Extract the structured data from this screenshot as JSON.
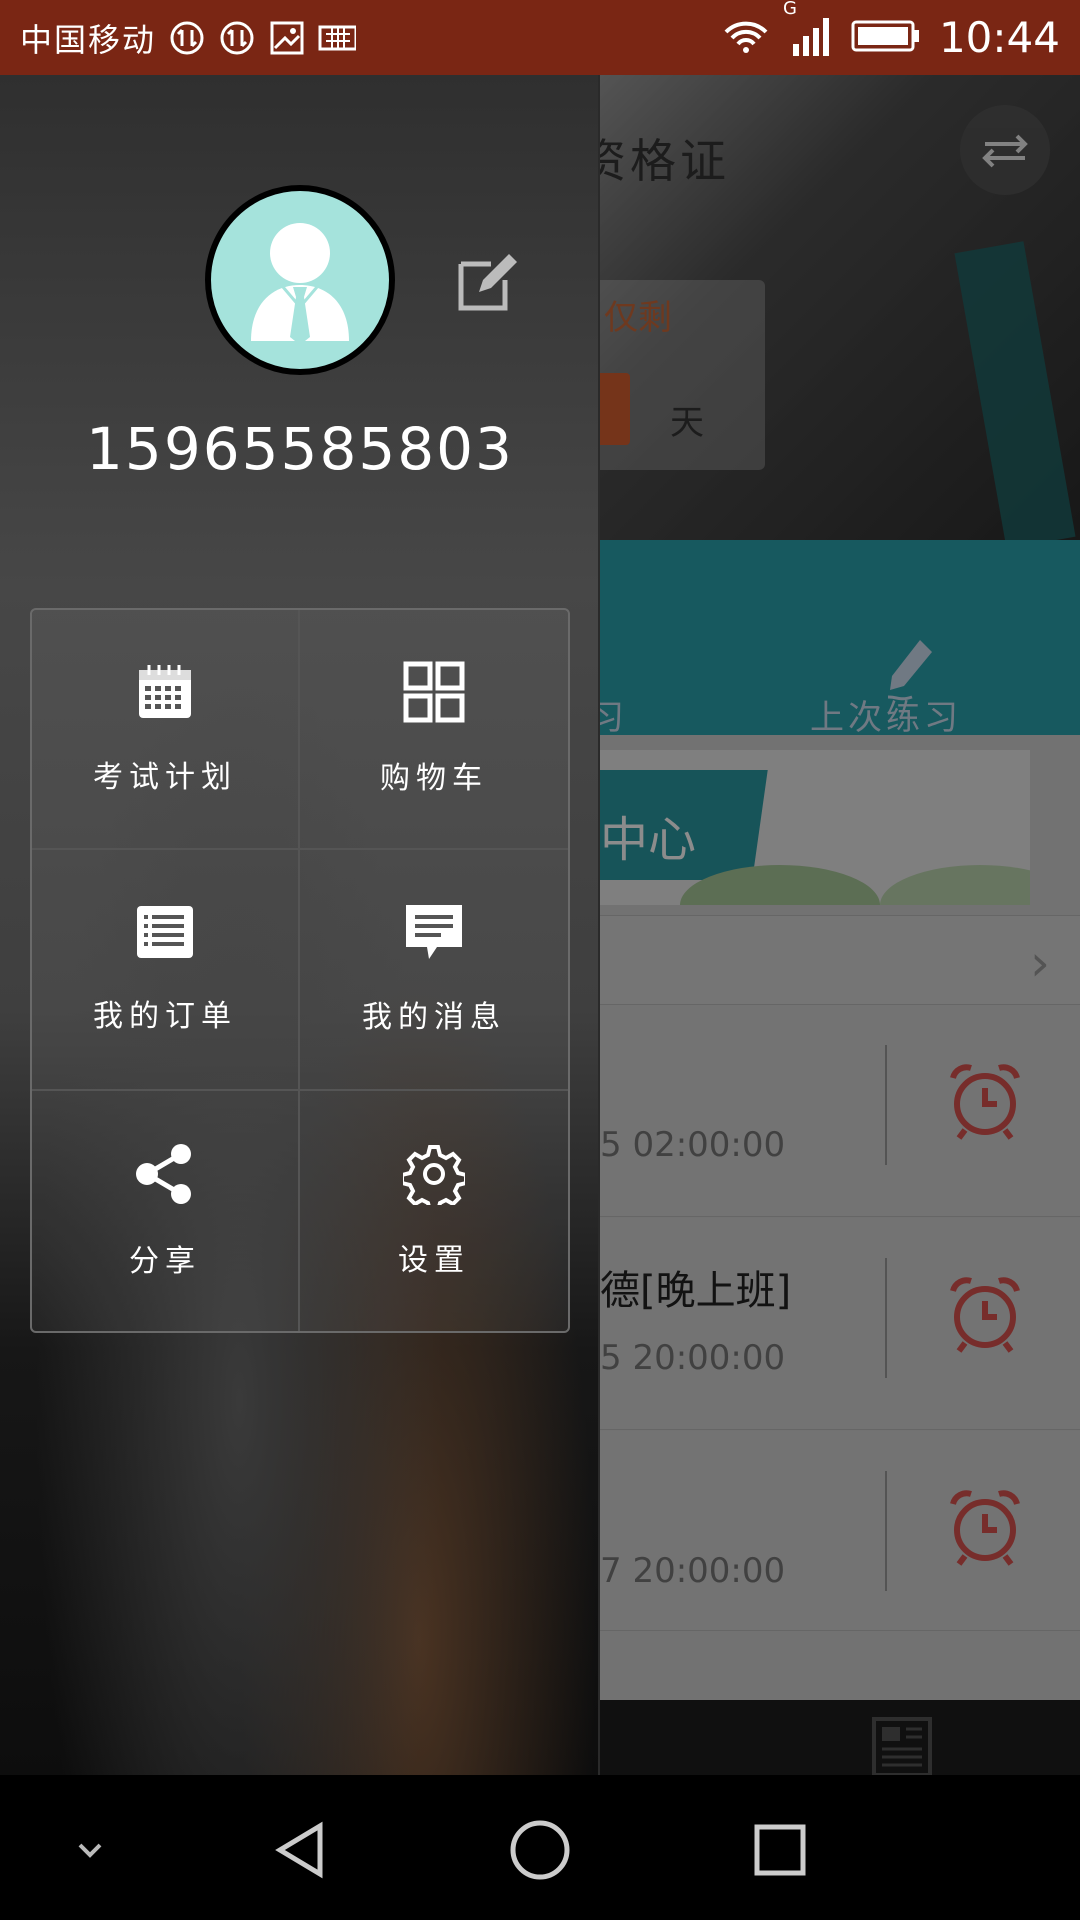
{
  "status_bar": {
    "carrier": "中国移动",
    "network": "G",
    "time": "10:44"
  },
  "background_app": {
    "title": "资格证",
    "countdown_label": "仅剩",
    "countdown_unit": "天",
    "teal_partial": "习",
    "last_practice": "上次练习",
    "banner_text": "中心",
    "exams": [
      {
        "title": "",
        "time": "5 02:00:00"
      },
      {
        "title": "德[晚上班]",
        "time": "5 20:00:00"
      },
      {
        "title": "",
        "time": "7 20:00:00"
      }
    ],
    "news_tab": "资讯"
  },
  "drawer": {
    "phone": "15965585803",
    "menu": [
      {
        "label": "考试计划",
        "icon": "calendar-icon"
      },
      {
        "label": "购物车",
        "icon": "grid-icon"
      },
      {
        "label": "我的订单",
        "icon": "list-icon"
      },
      {
        "label": "我的消息",
        "icon": "message-icon"
      },
      {
        "label": "分享",
        "icon": "share-icon"
      },
      {
        "label": "设置",
        "icon": "gear-icon"
      }
    ]
  },
  "colors": {
    "status_bar": "#7a2614",
    "teal": "#2aa3ad",
    "avatar_bg": "#a5e3dc",
    "alarm": "#d9534f"
  }
}
